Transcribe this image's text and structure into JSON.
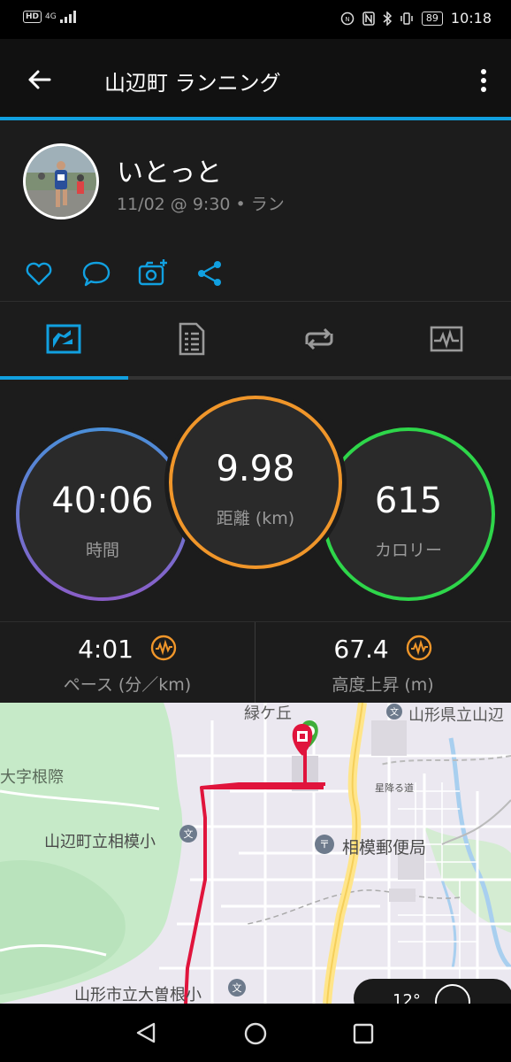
{
  "status_bar": {
    "left_indicator": "HD",
    "network": "4G",
    "battery": "89",
    "time": "10:18"
  },
  "app_bar": {
    "title": "山辺町 ランニング"
  },
  "profile": {
    "name": "いとっと",
    "meta": "11/02 @ 9:30 • ラン"
  },
  "stats": {
    "time": {
      "value": "40:06",
      "label": "時間"
    },
    "distance": {
      "value": "9.98",
      "label": "距離 (km)"
    },
    "calories": {
      "value": "615",
      "label": "カロリー"
    }
  },
  "metrics": {
    "pace": {
      "value": "4:01",
      "label": "ペース (分／km)"
    },
    "elevation": {
      "value": "67.4",
      "label": "高度上昇 (m)"
    }
  },
  "map": {
    "labels": {
      "midorigaoka": "緑ケ丘",
      "school_top": "山形県立山辺",
      "oaza": "大字根際",
      "star_road": "星降る道",
      "sagami_school": "山辺町立相模小",
      "post_office": "相模郵便局",
      "osone_school": "山形市立大曽根小"
    },
    "temperature_partial": "12°"
  },
  "colors": {
    "accent": "#11a0e0",
    "time_ring_from": "#4a8fd8",
    "time_ring_to": "#8a5ec8",
    "distance_ring": "#f0962a",
    "calories_ring": "#2ed64a",
    "route": "#e0143c",
    "metric_icon": "#f0962a"
  }
}
